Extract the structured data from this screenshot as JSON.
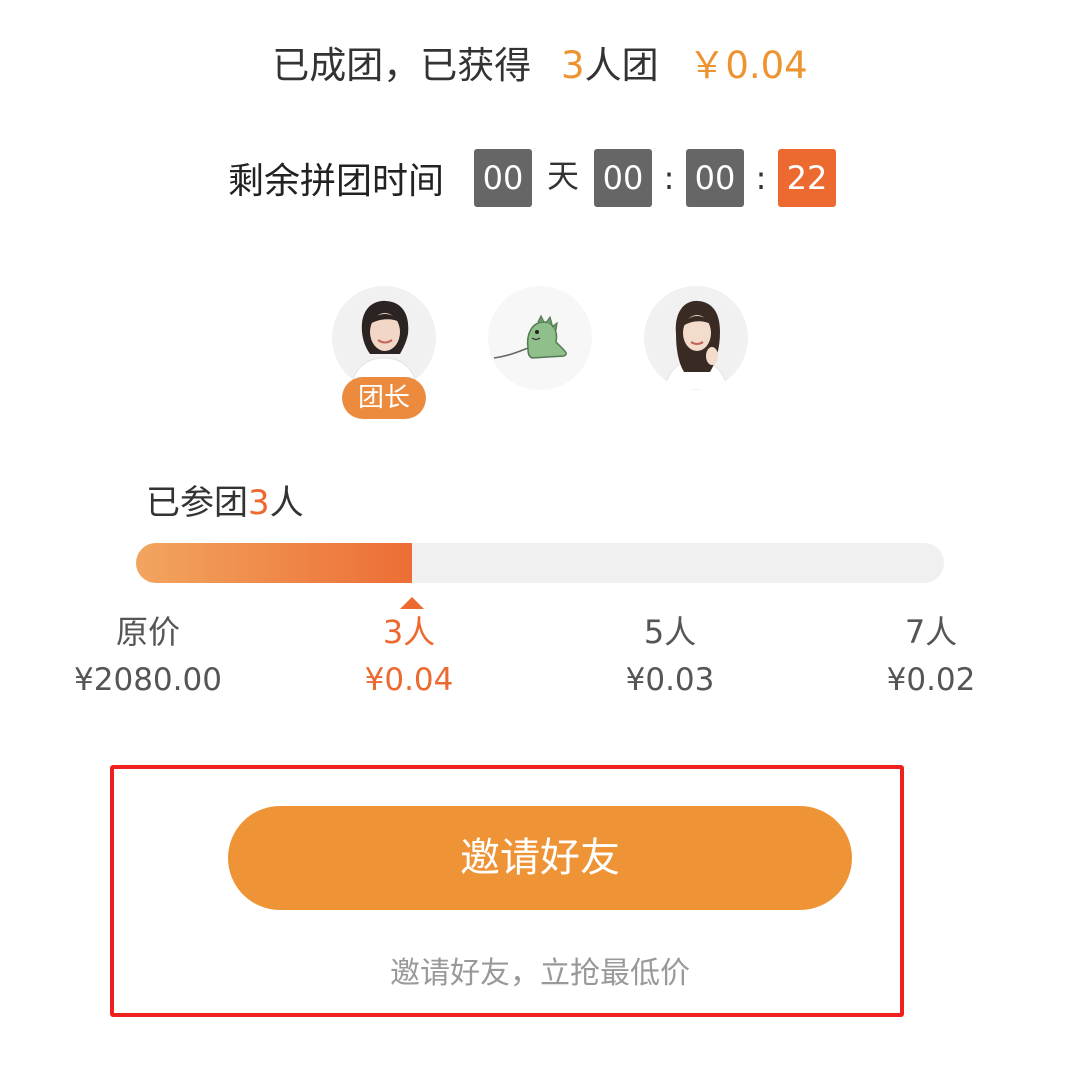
{
  "header": {
    "status_text": "已成团，已获得",
    "group_size": "3",
    "group_unit": "人团",
    "price": "￥0.04"
  },
  "countdown": {
    "label": "剩余拼团时间",
    "days": "00",
    "day_unit": "天",
    "hours": "00",
    "sep1": ":",
    "minutes": "00",
    "sep2": ":",
    "seconds": "22"
  },
  "members": {
    "leader_badge": "团长",
    "avatars": [
      "member-leader-photo",
      "dinosaur-avatar",
      "member-photo"
    ]
  },
  "progress": {
    "joined_prefix": "已参团",
    "joined_count": "3",
    "joined_suffix": "人",
    "tiers": [
      {
        "label": "原价",
        "price": "¥2080.00"
      },
      {
        "label": "3人",
        "price": "¥0.04"
      },
      {
        "label": "5人",
        "price": "¥0.03"
      },
      {
        "label": "7人",
        "price": "¥0.02"
      }
    ],
    "active_tier_index": 1
  },
  "invite": {
    "button_label": "邀请好友",
    "hint": "邀请好友，立抢最低价"
  },
  "colors": {
    "accent": "#ec6930",
    "button": "#ee9436",
    "highlight_border": "#f0201c",
    "timer_box": "#666666"
  }
}
